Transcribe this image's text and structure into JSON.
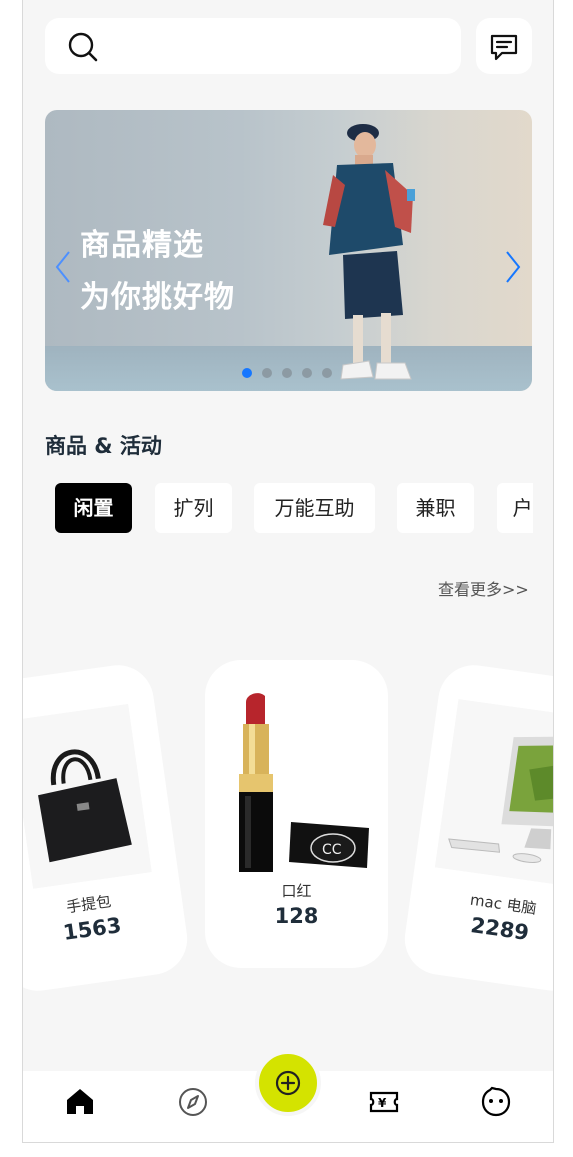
{
  "banner": {
    "line1": "商品精选",
    "line2": "为你挑好物",
    "slide_count": 5,
    "active_slide": 1
  },
  "section": {
    "title": "商品 & 活动",
    "tabs": [
      "闲置",
      "扩列",
      "万能互助",
      "兼职",
      "户"
    ],
    "active_tab": 0,
    "more_label": "查看更多>>"
  },
  "products": [
    {
      "name": "手提包",
      "price": "1563"
    },
    {
      "name": "口红",
      "price": "128"
    },
    {
      "name": "mac 电脑",
      "price": "2289"
    }
  ],
  "tabbar": {
    "items": [
      "home-icon",
      "compass-icon",
      "add-icon",
      "ticket-icon",
      "chat-face-icon"
    ],
    "active": "home-icon",
    "accent": "#d4e300"
  },
  "colors": {
    "accent_blue": "#1677ff",
    "background": "#f6f6f6",
    "fab": "#d4e300"
  }
}
